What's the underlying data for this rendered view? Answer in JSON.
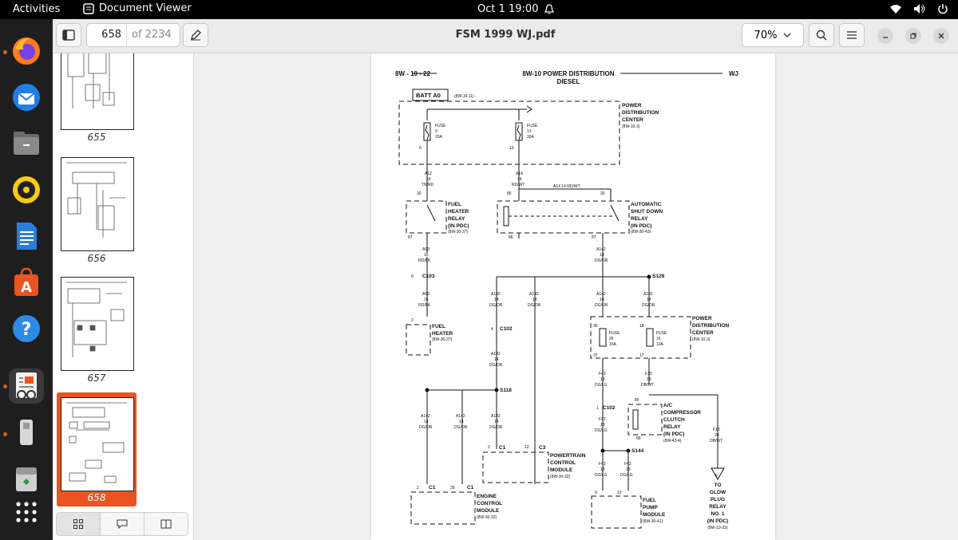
{
  "topbar": {
    "activities": "Activities",
    "app_name": "Document Viewer",
    "datetime": "Oct 1  19:00"
  },
  "dock": {
    "apps": [
      "firefox-icon",
      "thunderbird-icon",
      "files-icon",
      "rhythmbox-icon",
      "writer-icon",
      "app-center-icon",
      "help-icon",
      "document-viewer-icon",
      "usb-drive-icon",
      "trash-icon",
      "show-apps-icon"
    ]
  },
  "header": {
    "current_page": "658",
    "total_pages": "of 2234",
    "title": "FSM 1999 WJ.pdf",
    "zoom": "70%"
  },
  "sidebar": {
    "thumbnails": [
      {
        "label": "655"
      },
      {
        "label": "656"
      },
      {
        "label": "657"
      },
      {
        "label": "658",
        "selected": true
      }
    ]
  },
  "diagram": {
    "page_id": "8W - 10 - 22",
    "heading": "8W-10 POWER DISTRIBUTION",
    "subheading": "DIESEL",
    "model": "WJ",
    "batt": "BATT A0",
    "batt_ref": "(8W-10-11)",
    "pdc1": [
      "POWER",
      "DISTRIBUTION",
      "CENTER",
      "(8W-10-3)"
    ],
    "fuse9": [
      "FUSE",
      "9",
      "20A"
    ],
    "fuse13": [
      "FUSE",
      "13",
      "30A"
    ],
    "pin6": "6",
    "pin13": "13",
    "wireA12": [
      "A12",
      "16",
      "TN/RD"
    ],
    "wireA14": [
      "A14",
      "14",
      "RD/WT"
    ],
    "wireA14b": "A14   14 RD/WT",
    "fhr": [
      "FUEL",
      "HEATER",
      "RELAY",
      "(IN PDC)",
      "(8W-30-37)"
    ],
    "asd": [
      "AUTOMATIC",
      "SHUT DOWN",
      "RELAY",
      "(IN PDC)",
      "(8W-30-43)"
    ],
    "pin30a": "30",
    "pin87a": "87",
    "pin85": "85",
    "pin86": "86",
    "pin30b": "30",
    "pin87b": "87",
    "wireA93": [
      "A93",
      "16",
      "RD/BK"
    ],
    "wireA142a": [
      "A142",
      "14",
      "DG/OR"
    ],
    "c103": "C103",
    "c103pin": "6",
    "s128": "S128",
    "wireA93b": [
      "A93",
      "16",
      "RD/BK"
    ],
    "wireA142b": [
      "A142",
      "14",
      "DG/OR"
    ],
    "wireA142c": [
      "A142",
      "14",
      "DG/OR"
    ],
    "wireA142d": [
      "A142",
      "14",
      "DG/OR"
    ],
    "wireA142e": [
      "A142",
      "14",
      "DG/OR"
    ],
    "fh": [
      "FUEL",
      "HEATER",
      "(8W-30-37)"
    ],
    "fhpin": "2",
    "c102": "C102",
    "c102pin": "4",
    "pdc2": [
      "POWER",
      "DISTRIBUTION",
      "CENTER",
      "(8W-10-3)"
    ],
    "fuse26": [
      "FUSE",
      "26",
      "15A"
    ],
    "fuse16": [
      "FUSE",
      "16",
      "10A"
    ],
    "pin36": "36",
    "pin18": "18",
    "pin37": "37",
    "pin17": "17",
    "wireA142f": [
      "A142",
      "14",
      "DG/OR"
    ],
    "wireF42": [
      "F42",
      "18",
      "DG/LG"
    ],
    "wireF15": [
      "F15",
      "18",
      "DB/WT"
    ],
    "s118": "S118",
    "c102b": "C102",
    "c102bpin": "1",
    "acr": [
      "A/C",
      "COMPRESSOR",
      "CLUTCH",
      "RELAY",
      "(IN PDC)",
      "(8W-42-4)"
    ],
    "pin85b": "85",
    "pin86b": "86",
    "wireA142g": [
      "A142",
      "14",
      "DG/OR"
    ],
    "wireA142h": [
      "A142",
      "14",
      "DG/OR"
    ],
    "wireA142i": [
      "A142",
      "14",
      "DG/OR"
    ],
    "wireF42b": [
      "F42",
      "18",
      "DG/LG"
    ],
    "wireF15b": [
      "F15",
      "20",
      "DB/WT"
    ],
    "c1": "C1",
    "c3": "C3",
    "c1pin": "2",
    "c3pin": "12",
    "pcm": [
      "POWERTRAIN",
      "CONTROL",
      "MODULE",
      "(8W-30-32)"
    ],
    "s144": "S144",
    "wireF42c": [
      "F42",
      "18",
      "DG/LG"
    ],
    "wireF42d": [
      "F42",
      "18",
      "DG/LG"
    ],
    "ecm_c1a": "C1",
    "ecm_c1b": "C1",
    "ecm_pin2": "2",
    "ecm_pin28": "28",
    "ecm": [
      "ENGINE",
      "CONTROL",
      "MODULE",
      "(8W-30-32)"
    ],
    "fpm": [
      "FUEL",
      "PUMP",
      "MODULE",
      "(8W-30-41)"
    ],
    "fpm_pin9": "9",
    "fpm_pin10": "10",
    "glow": [
      "TO",
      "GLOW",
      "PLUG",
      "RELAY",
      "NO. 1",
      "(IN PDC)",
      "(8W-10-23)"
    ],
    "glow_e": "E"
  }
}
